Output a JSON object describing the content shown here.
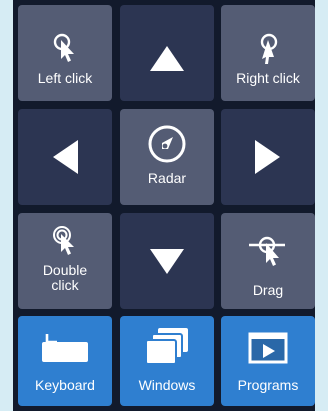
{
  "buttons": {
    "left_click": {
      "label": "Left click",
      "icon": "pointer-tap-icon"
    },
    "up": {
      "icon": "arrow-up-icon"
    },
    "right_click": {
      "label": "Right click",
      "icon": "pointer-tap-icon"
    },
    "left": {
      "icon": "arrow-left-icon"
    },
    "radar": {
      "label": "Radar",
      "icon": "compass-icon"
    },
    "right": {
      "icon": "arrow-right-icon"
    },
    "double_click": {
      "label": "Double click",
      "icon": "pointer-double-tap-icon"
    },
    "down": {
      "icon": "arrow-down-icon"
    },
    "drag": {
      "label": "Drag",
      "icon": "pointer-drag-icon"
    },
    "keyboard": {
      "label": "Keyboard",
      "icon": "keyboard-icon"
    },
    "windows": {
      "label": "Windows",
      "icon": "stacked-windows-icon"
    },
    "programs": {
      "label": "Programs",
      "icon": "play-window-icon"
    }
  },
  "colors": {
    "background": "#d6ecf4",
    "panel": "#121a2c",
    "action_button": "#545c74",
    "arrow_button": "#2c3552",
    "launcher_button": "#2f7fd0",
    "text": "#ffffff"
  }
}
